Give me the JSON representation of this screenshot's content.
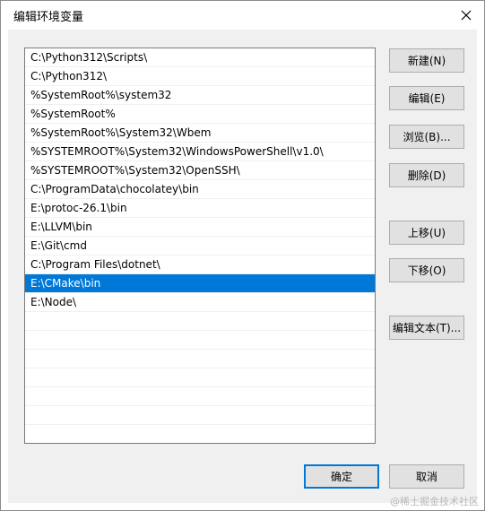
{
  "window": {
    "title": "编辑环境变量"
  },
  "path_list": [
    "C:\\Python312\\Scripts\\",
    "C:\\Python312\\",
    "%SystemRoot%\\system32",
    "%SystemRoot%",
    "%SystemRoot%\\System32\\Wbem",
    "%SYSTEMROOT%\\System32\\WindowsPowerShell\\v1.0\\",
    "%SYSTEMROOT%\\System32\\OpenSSH\\",
    "C:\\ProgramData\\chocolatey\\bin",
    "E:\\protoc-26.1\\bin",
    "E:\\LLVM\\bin",
    "E:\\Git\\cmd",
    "C:\\Program Files\\dotnet\\",
    "E:\\CMake\\bin",
    "E:\\Node\\",
    "",
    "",
    "",
    "",
    "",
    "",
    ""
  ],
  "selected_index": 12,
  "buttons": {
    "new": "新建(N)",
    "edit": "编辑(E)",
    "browse": "浏览(B)...",
    "delete": "删除(D)",
    "move_up": "上移(U)",
    "move_down": "下移(O)",
    "edit_text": "编辑文本(T)...",
    "ok": "确定",
    "cancel": "取消"
  },
  "watermark": "@稀土掘金技术社区",
  "colors": {
    "selection": "#0078d7",
    "default_button_border": "#0078d7"
  }
}
